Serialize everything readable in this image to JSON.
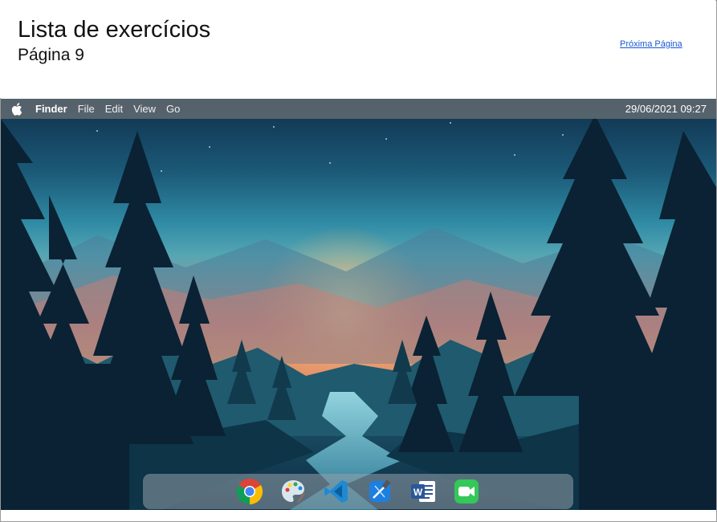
{
  "page": {
    "title": "Lista de exercícios",
    "subtitle": "Página 9",
    "next_link": "Próxima Página"
  },
  "menubar": {
    "app_name": "Finder",
    "items": [
      "File",
      "Edit",
      "View",
      "Go"
    ],
    "clock": "29/06/2021 09:27"
  },
  "dock": {
    "apps": [
      {
        "name": "Google Chrome",
        "icon": "chrome-icon"
      },
      {
        "name": "Paint",
        "icon": "palette-icon"
      },
      {
        "name": "Visual Studio Code",
        "icon": "vscode-icon"
      },
      {
        "name": "Xcode",
        "icon": "xcode-icon"
      },
      {
        "name": "Microsoft Word",
        "icon": "word-icon"
      },
      {
        "name": "FaceTime",
        "icon": "facetime-icon"
      }
    ]
  },
  "colors": {
    "link": "#1a57d6",
    "menubar": "#5f6970",
    "dock": "#96a0aa"
  }
}
